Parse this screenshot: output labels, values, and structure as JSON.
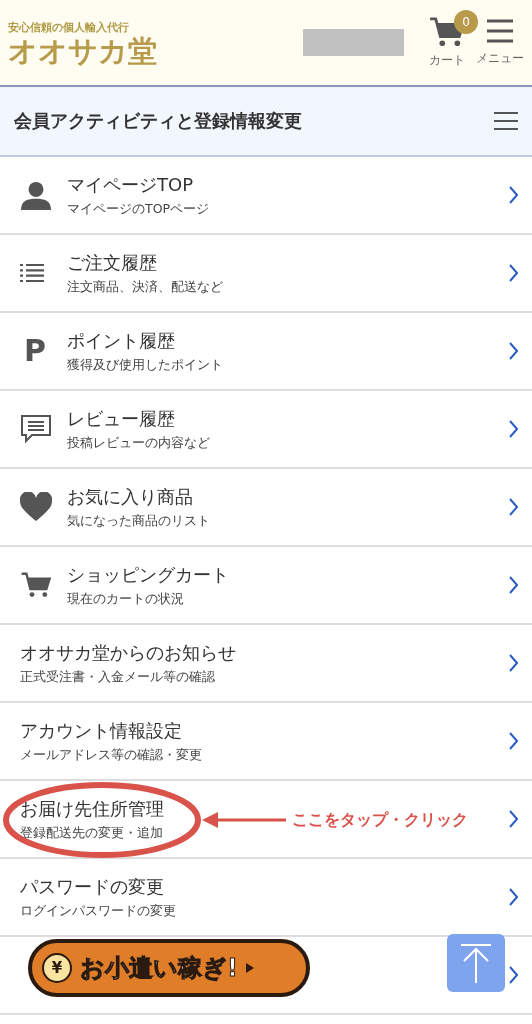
{
  "header": {
    "tagline": "安心信頼の個人輸入代行",
    "logo": "オオサカ堂",
    "cart": {
      "count": "0",
      "label": "カート"
    },
    "menu": {
      "label": "メニュー"
    }
  },
  "section": {
    "title": "会員アクティビティと登録情報変更"
  },
  "rows": [
    {
      "kind": "person",
      "title": "マイページTOP",
      "subtitle": "マイページのTOPページ",
      "highlighted": false
    },
    {
      "kind": "list",
      "title": "ご注文履歴",
      "subtitle": "注文商品、決済、配送など",
      "highlighted": false
    },
    {
      "kind": "char",
      "icon_char": "P",
      "title": "ポイント履歴",
      "subtitle": "獲得及び使用したポイント",
      "highlighted": false
    },
    {
      "kind": "chat",
      "title": "レビュー履歴",
      "subtitle": "投稿レビューの内容など",
      "highlighted": false
    },
    {
      "kind": "heart",
      "title": "お気に入り商品",
      "subtitle": "気になった商品のリスト",
      "highlighted": false
    },
    {
      "kind": "cart",
      "title": "ショッピングカート",
      "subtitle": "現在のカートの状況",
      "highlighted": false
    },
    {
      "kind": "plain",
      "title": "オオサカ堂からのお知らせ",
      "subtitle": "正式受注書・入金メール等の確認",
      "highlighted": false
    },
    {
      "kind": "plain",
      "title": "アカウント情報設定",
      "subtitle": "メールアドレス等の確認・変更",
      "highlighted": false
    },
    {
      "kind": "plain",
      "title": "お届け先住所管理",
      "subtitle": "登録配送先の変更・追加",
      "highlighted": true,
      "annotation": "ここをタップ・クリック"
    },
    {
      "kind": "plain",
      "title": "パスワードの変更",
      "subtitle": "ログインパスワードの変更",
      "highlighted": false
    }
  ],
  "banner": {
    "coin": "¥",
    "label": "お小遣い稼ぎ!"
  }
}
